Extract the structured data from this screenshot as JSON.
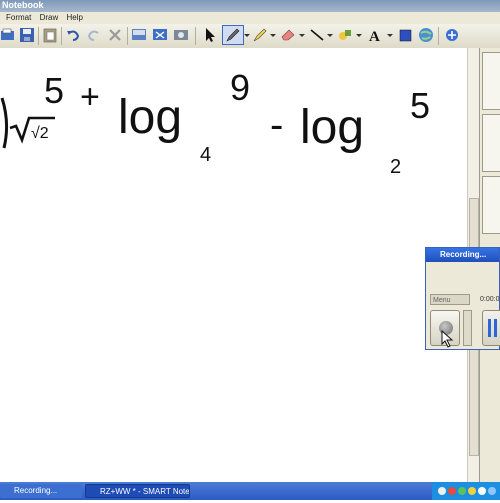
{
  "window": {
    "title": "Notebook"
  },
  "menu": {
    "items": [
      "Format",
      "Draw",
      "Help"
    ]
  },
  "toolbar": {
    "tools": [
      "open-icon",
      "save-icon",
      "paste-icon",
      "undo-icon",
      "redo-icon",
      "delete-icon",
      "screen-shade-icon",
      "full-screen-icon",
      "capture-icon",
      "select-icon",
      "pen-icon",
      "highlighter-icon",
      "eraser-icon",
      "line-icon",
      "shape-icon",
      "text-icon",
      "fill-icon",
      "globe-icon",
      "properties-icon"
    ]
  },
  "canvas": {
    "expression": {
      "radical": "√2",
      "exponent1": "5",
      "op1": "+",
      "log1": "log",
      "base1": "4",
      "arg1": "9",
      "op2": "-",
      "log2": "log",
      "base2": "2",
      "arg2": "5"
    }
  },
  "recorder": {
    "title": "Recording...",
    "menu_label": "Menu",
    "time": "0:00:0"
  },
  "taskbar": {
    "items": [
      "Recording...",
      "RZ+WW * - SMART Note..."
    ]
  }
}
